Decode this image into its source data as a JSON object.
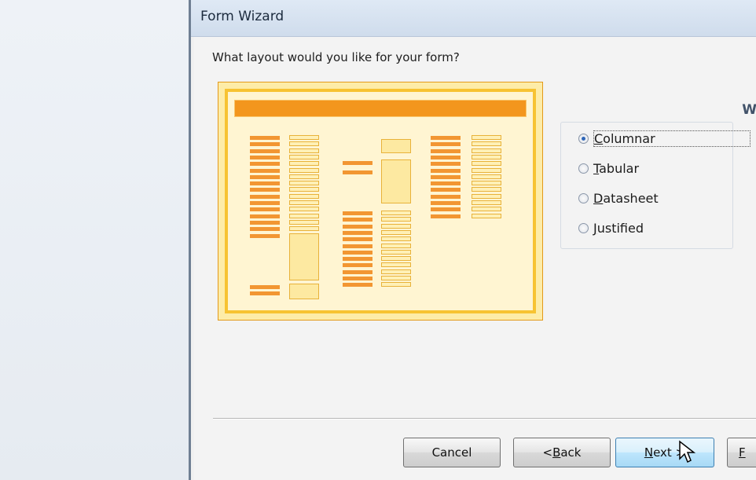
{
  "window": {
    "title": "Form Wizard"
  },
  "question": "What layout would you like for your form?",
  "edge_text": "W",
  "layout_options": [
    {
      "key": "C",
      "rest": "olumnar",
      "selected": true
    },
    {
      "key": "T",
      "rest": "abular",
      "selected": false
    },
    {
      "key": "D",
      "rest": "atasheet",
      "selected": false
    },
    {
      "key": "J",
      "rest": "ustified",
      "selected": false
    }
  ],
  "buttons": {
    "cancel": "Cancel",
    "back_prefix": "< ",
    "back_key": "B",
    "back_rest": "ack",
    "next_key": "N",
    "next_rest": "ext >",
    "finish_key": "F"
  },
  "colors": {
    "accent_orange": "#f3961d",
    "preview_yellow": "#fde9a1",
    "radio_selected": "#2f67b8"
  }
}
